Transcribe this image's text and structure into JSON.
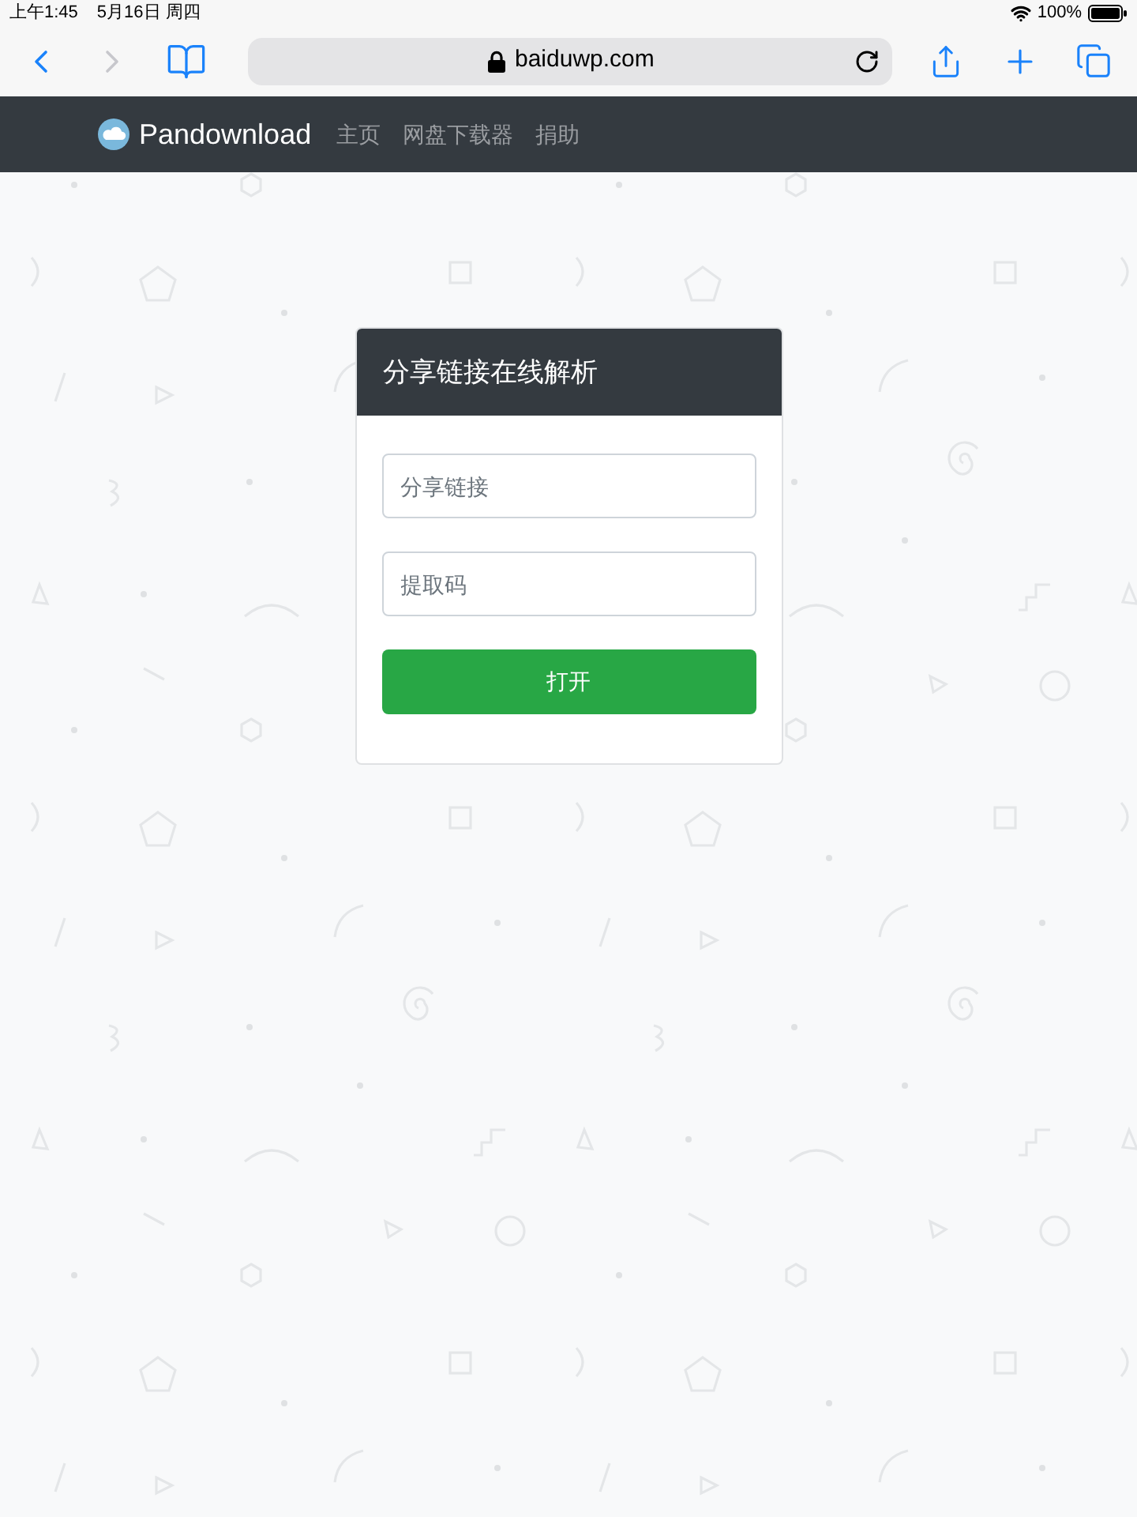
{
  "status_bar": {
    "time": "上午1:45",
    "date": "5月16日 周四",
    "battery": "100%"
  },
  "browser_toolbar": {
    "back": {
      "disabled": false
    },
    "forward": {
      "disabled": true
    },
    "address": "baiduwp.com"
  },
  "navbar": {
    "brand": "Pandownload",
    "links": [
      "主页",
      "网盘下载器",
      "捐助"
    ]
  },
  "card": {
    "title": "分享链接在线解析",
    "fields": [
      {
        "placeholder": "分享链接"
      },
      {
        "placeholder": "提取码"
      }
    ],
    "button": "打开"
  }
}
